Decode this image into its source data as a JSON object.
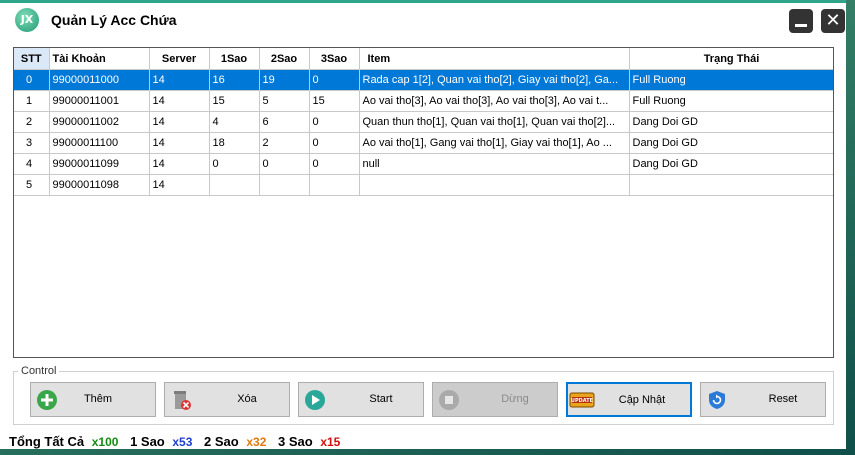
{
  "window": {
    "title": "Quản Lý Acc Chứa",
    "logo_text": "JX"
  },
  "table": {
    "columns": [
      "STT",
      "Tài Khoản",
      "Server",
      "1Sao",
      "2Sao",
      "3Sao",
      "Item",
      "Trạng Thái"
    ],
    "selected_row": 0,
    "rows": [
      {
        "stt": "0",
        "account": "99000011000",
        "server": "14",
        "s1": "16",
        "s2": "19",
        "s3": "0",
        "item": "Rada cap 1[2], Quan vai tho[2], Giay vai tho[2], Ga...",
        "status": "Full Ruong"
      },
      {
        "stt": "1",
        "account": "99000011001",
        "server": "14",
        "s1": "15",
        "s2": "5",
        "s3": "15",
        "item": "Ao vai tho[3], Ao vai tho[3], Ao vai tho[3], Ao vai t...",
        "status": "Full Ruong"
      },
      {
        "stt": "2",
        "account": "99000011002",
        "server": "14",
        "s1": "4",
        "s2": "6",
        "s3": "0",
        "item": "Quan thun tho[1], Quan vai tho[1], Quan vai tho[2]...",
        "status": "Dang Doi GD"
      },
      {
        "stt": "3",
        "account": "99000011100",
        "server": "14",
        "s1": "18",
        "s2": "2",
        "s3": "0",
        "item": "Ao vai tho[1], Gang vai tho[1], Giay vai tho[1], Ao ...",
        "status": "Dang Doi GD"
      },
      {
        "stt": "4",
        "account": "99000011099",
        "server": "14",
        "s1": "0",
        "s2": "0",
        "s3": "0",
        "item": "null",
        "status": "Dang Doi GD"
      },
      {
        "stt": "5",
        "account": "99000011098",
        "server": "14",
        "s1": "",
        "s2": "",
        "s3": "",
        "item": "",
        "status": ""
      }
    ]
  },
  "control": {
    "label": "Control",
    "buttons": [
      {
        "id": "add",
        "label": "Thêm",
        "icon": "plus-circle-icon"
      },
      {
        "id": "delete",
        "label": "Xóa",
        "icon": "trash-icon"
      },
      {
        "id": "start",
        "label": "Start",
        "icon": "play-icon"
      },
      {
        "id": "stop",
        "label": "Dừng",
        "icon": "stop-icon",
        "disabled": true
      },
      {
        "id": "update",
        "label": "Cập Nhật",
        "icon": "update-icon",
        "focused": true
      },
      {
        "id": "reset",
        "label": "Reset",
        "icon": "refresh-shield-icon"
      }
    ]
  },
  "summary": {
    "total_label": "Tổng Tất Cả",
    "total_value": "x100",
    "s1_label": "1 Sao",
    "s1_value": "x53",
    "s2_label": "2 Sao",
    "s2_value": "x32",
    "s3_label": "3 Sao",
    "s3_value": "x15"
  },
  "colors": {
    "accent": "#2ea58a",
    "selection": "#0078d7",
    "total": "#138a13",
    "s1": "#1f3fcf",
    "s2": "#e07a10",
    "s3": "#d01010"
  }
}
